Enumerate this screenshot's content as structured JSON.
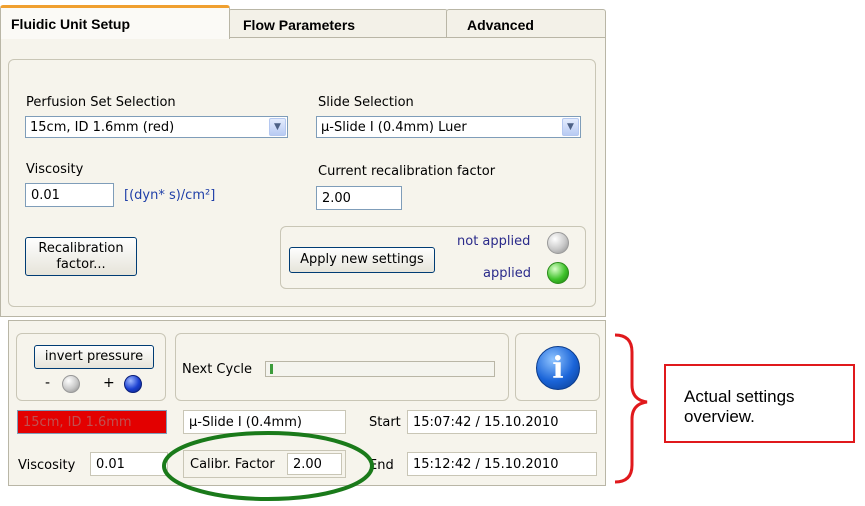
{
  "tabs": [
    {
      "label": "Fluidic Unit Setup",
      "active": true
    },
    {
      "label": "Flow Parameters",
      "active": false
    },
    {
      "label": "Advanced",
      "active": false
    }
  ],
  "setup": {
    "perfusion_label": "Perfusion Set Selection",
    "perfusion_value": "15cm, ID 1.6mm (red)",
    "slide_label": "Slide Selection",
    "slide_value": "µ-Slide I (0.4mm) Luer",
    "viscosity_label": "Viscosity",
    "viscosity_value": "0.01",
    "viscosity_unit": "[(dyn* s)/cm²]",
    "recal_label": "Current recalibration factor",
    "recal_value": "2.00",
    "recal_button": "Recalibration factor...",
    "apply_button": "Apply new settings",
    "not_applied_label": "not applied",
    "applied_label": "applied"
  },
  "overview": {
    "invert_button": "invert pressure",
    "minus": "-",
    "plus": "+",
    "next_cycle_label": "Next Cycle",
    "next_cycle_progress": 0.01,
    "perfusion_set": "15cm, ID 1.6mm",
    "slide": "µ-Slide I (0.4mm)",
    "start_label": "Start",
    "start_value": "15:07:42 / 15.10.2010",
    "viscosity_label": "Viscosity",
    "viscosity_value": "0.01",
    "calibr_label": "Calibr. Factor",
    "calibr_value": "2.00",
    "end_label": "End",
    "end_value": "15:12:42 / 15.10.2010"
  },
  "callout": {
    "text": "Actual settings overview."
  },
  "colors": {
    "red_mark": "#e0191c",
    "green_mark": "#1a7a1a",
    "perfusion_red": "#e30000",
    "led_green": "#3ec22a",
    "led_grey": "#c8c8c8",
    "led_blue": "#1a3fd0"
  }
}
